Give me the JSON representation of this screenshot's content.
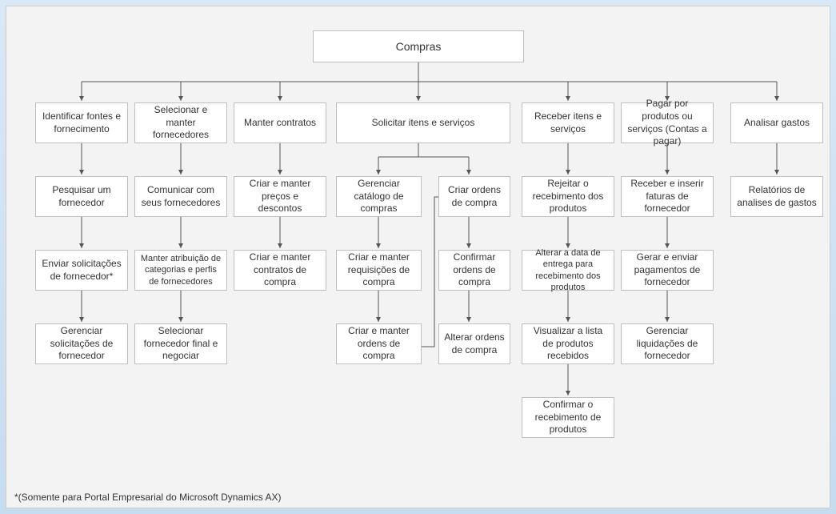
{
  "footnote": "*(Somente para Portal Empresarial do Microsoft Dynamics AX)",
  "root": {
    "label": "Compras"
  },
  "columns": [
    {
      "head": "Identificar fontes e fornecimento",
      "items": [
        "Pesquisar um fornecedor",
        "Enviar solicitações de fornecedor*",
        "Gerenciar solicitações de fornecedor"
      ]
    },
    {
      "head": "Selecionar e manter fornecedores",
      "items": [
        "Comunicar com seus fornecedores",
        "Manter atribuição de categorias e perfis de fornecedores",
        "Selecionar fornecedor final e negociar"
      ]
    },
    {
      "head": "Manter contratos",
      "items": [
        "Criar e manter preços e descontos",
        "Criar e manter contratos de compra"
      ]
    },
    {
      "head": "Solicitar itens e serviços",
      "sub": [
        {
          "items": [
            "Gerenciar catálogo de compras",
            "Criar e manter requisições de compra",
            "Criar e manter ordens de compra"
          ]
        },
        {
          "items": [
            "Criar ordens de compra",
            "Confirmar ordens de compra",
            "Alterar ordens de compra"
          ]
        }
      ]
    },
    {
      "head": "Receber itens e serviços",
      "items": [
        "Rejeitar o recebimento dos produtos",
        "Alterar a data de entrega para recebimento dos produtos",
        "Visualizar a lista de produtos recebidos",
        "Confirmar o recebimento de produtos"
      ]
    },
    {
      "head": "Pagar por produtos ou serviços (Contas a pagar)",
      "items": [
        "Receber e inserir faturas de fornecedor",
        "Gerar e enviar pagamentos de fornecedor",
        "Gerenciar liquidações de fornecedor"
      ]
    },
    {
      "head": "Analisar gastos",
      "items": [
        "Relatórios de analises de gastos"
      ]
    }
  ],
  "chart_data": {
    "type": "tree",
    "root": "Compras",
    "children": [
      {
        "name": "Identificar fontes e fornecimento",
        "children": [
          "Pesquisar um fornecedor",
          "Enviar solicitações de fornecedor*",
          "Gerenciar solicitações de fornecedor"
        ]
      },
      {
        "name": "Selecionar e manter fornecedores",
        "children": [
          "Comunicar com seus fornecedores",
          "Manter atribuição de categorias e perfis de fornecedores",
          "Selecionar fornecedor final e negociar"
        ]
      },
      {
        "name": "Manter contratos",
        "children": [
          "Criar e manter preços e descontos",
          "Criar e manter contratos de compra"
        ]
      },
      {
        "name": "Solicitar itens e serviços",
        "children": [
          {
            "name": "_branch_a",
            "children": [
              "Gerenciar catálogo de compras",
              "Criar e manter requisições de compra",
              "Criar e manter ordens de compra"
            ]
          },
          {
            "name": "_branch_b",
            "children": [
              "Criar ordens de compra",
              "Confirmar ordens de compra",
              "Alterar ordens de compra"
            ]
          }
        ],
        "cross_link": {
          "from": "Criar e manter ordens de compra",
          "to": "Criar ordens de compra"
        }
      },
      {
        "name": "Receber itens e serviços",
        "children": [
          "Rejeitar o recebimento dos produtos",
          "Alterar a data de entrega para recebimento dos produtos",
          "Visualizar a lista de produtos recebidos",
          "Confirmar o recebimento de produtos"
        ]
      },
      {
        "name": "Pagar por produtos ou serviços (Contas a pagar)",
        "children": [
          "Receber e inserir faturas de fornecedor",
          "Gerar e enviar pagamentos de fornecedor",
          "Gerenciar liquidações de fornecedor"
        ]
      },
      {
        "name": "Analisar gastos",
        "children": [
          "Relatórios de analises de gastos"
        ]
      }
    ]
  }
}
